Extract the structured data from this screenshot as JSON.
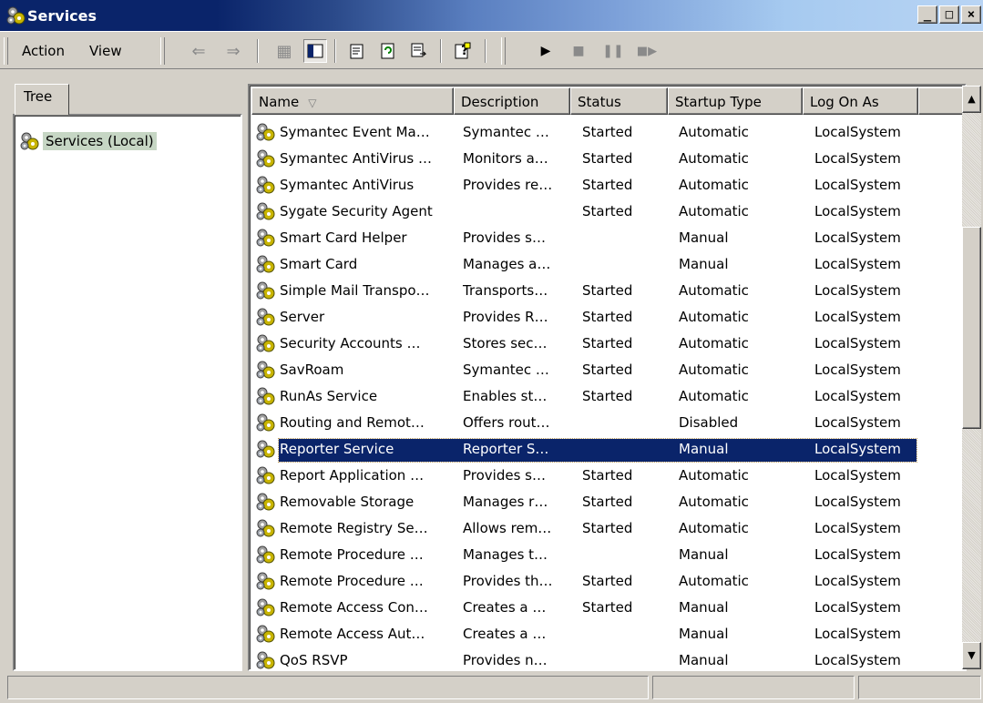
{
  "window": {
    "title": "Services",
    "buttons": {
      "minimize": "_",
      "maximize": "□",
      "close": "×"
    }
  },
  "toolbar": {
    "menus": [
      {
        "label": "Action"
      },
      {
        "label": "View"
      }
    ],
    "icons": [
      "back-arrow-icon",
      "forward-arrow-icon",
      "up-folder-icon",
      "show-hide-tree-icon",
      "properties-icon",
      "refresh-icon",
      "export-list-icon",
      "help-icon",
      "start-service-icon",
      "stop-service-icon",
      "pause-service-icon",
      "restart-service-icon"
    ]
  },
  "tree": {
    "tab_label": "Tree",
    "root_label": "Services (Local)"
  },
  "table": {
    "columns": [
      "Name",
      "Description",
      "Status",
      "Startup Type",
      "Log On As"
    ],
    "rows": [
      {
        "name": "Symantec Event Ma…",
        "description": "Symantec …",
        "status": "Started",
        "startup": "Automatic",
        "logon": "LocalSystem"
      },
      {
        "name": "Symantec AntiVirus …",
        "description": "Monitors a…",
        "status": "Started",
        "startup": "Automatic",
        "logon": "LocalSystem"
      },
      {
        "name": "Symantec AntiVirus",
        "description": "Provides re…",
        "status": "Started",
        "startup": "Automatic",
        "logon": "LocalSystem"
      },
      {
        "name": "Sygate Security Agent",
        "description": "",
        "status": "Started",
        "startup": "Automatic",
        "logon": "LocalSystem"
      },
      {
        "name": "Smart Card Helper",
        "description": "Provides s…",
        "status": "",
        "startup": "Manual",
        "logon": "LocalSystem"
      },
      {
        "name": "Smart Card",
        "description": "Manages a…",
        "status": "",
        "startup": "Manual",
        "logon": "LocalSystem"
      },
      {
        "name": "Simple Mail Transpo…",
        "description": "Transports…",
        "status": "Started",
        "startup": "Automatic",
        "logon": "LocalSystem"
      },
      {
        "name": "Server",
        "description": "Provides R…",
        "status": "Started",
        "startup": "Automatic",
        "logon": "LocalSystem"
      },
      {
        "name": "Security Accounts …",
        "description": "Stores sec…",
        "status": "Started",
        "startup": "Automatic",
        "logon": "LocalSystem"
      },
      {
        "name": "SavRoam",
        "description": "Symantec …",
        "status": "Started",
        "startup": "Automatic",
        "logon": "LocalSystem"
      },
      {
        "name": "RunAs Service",
        "description": "Enables st…",
        "status": "Started",
        "startup": "Automatic",
        "logon": "LocalSystem"
      },
      {
        "name": "Routing and Remot…",
        "description": "Offers rout…",
        "status": "",
        "startup": "Disabled",
        "logon": "LocalSystem"
      },
      {
        "name": "Reporter Service",
        "description": "Reporter S…",
        "status": "",
        "startup": "Manual",
        "logon": "LocalSystem",
        "selected": true
      },
      {
        "name": "Report Application …",
        "description": "Provides s…",
        "status": "Started",
        "startup": "Automatic",
        "logon": "LocalSystem"
      },
      {
        "name": "Removable Storage",
        "description": "Manages r…",
        "status": "Started",
        "startup": "Automatic",
        "logon": "LocalSystem"
      },
      {
        "name": "Remote Registry Se…",
        "description": "Allows rem…",
        "status": "Started",
        "startup": "Automatic",
        "logon": "LocalSystem"
      },
      {
        "name": "Remote Procedure …",
        "description": "Manages t…",
        "status": "",
        "startup": "Manual",
        "logon": "LocalSystem"
      },
      {
        "name": "Remote Procedure …",
        "description": "Provides th…",
        "status": "Started",
        "startup": "Automatic",
        "logon": "LocalSystem"
      },
      {
        "name": "Remote Access Con…",
        "description": "Creates a …",
        "status": "Started",
        "startup": "Manual",
        "logon": "LocalSystem"
      },
      {
        "name": "Remote Access Aut…",
        "description": "Creates a …",
        "status": "",
        "startup": "Manual",
        "logon": "LocalSystem"
      },
      {
        "name": "QoS RSVP",
        "description": "Provides n…",
        "status": "",
        "startup": "Manual",
        "logon": "LocalSystem"
      }
    ]
  },
  "colors": {
    "title_active": "#0a246a",
    "selection": "#0a246a",
    "face": "#d4d0c8",
    "tree_highlight": "#c6d6c4"
  }
}
